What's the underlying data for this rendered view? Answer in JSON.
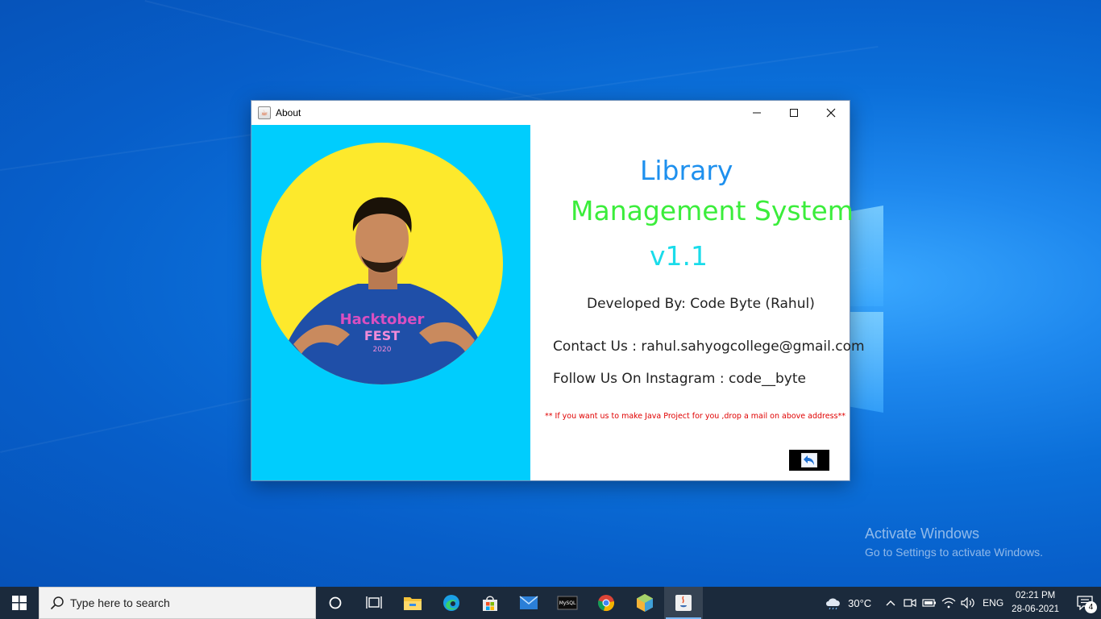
{
  "window": {
    "title": "About",
    "controls": {
      "minimize": "—",
      "maximize": "☐",
      "close": "✕"
    }
  },
  "about": {
    "line1": "Library",
    "line2": "Management System",
    "version": "v1.1",
    "developed_by": "Developed By: Code Byte (Rahul)",
    "contact": "Contact Us : rahul.sahyogcollege@gmail.com",
    "instagram": "Follow Us On Instagram : code__byte",
    "note": "** If you want us to make Java Project for you ,drop a mail on above address**"
  },
  "colors": {
    "library": "#1e90ee",
    "management": "#3bed3b",
    "version": "#1adcea",
    "left_panel": "#00cdfd",
    "circle": "#fde92c",
    "note": "#e00000"
  },
  "shirt_text": {
    "line1": "Hacktober",
    "line2": "FEST",
    "line3": "2020"
  },
  "activation": {
    "title": "Activate Windows",
    "subtitle": "Go to Settings to activate Windows."
  },
  "taskbar": {
    "search_placeholder": "Type here to search",
    "apps": [
      "cortana-icon",
      "task-view-icon",
      "file-explorer-icon",
      "edge-icon",
      "store-icon",
      "mail-icon",
      "mysql-icon",
      "chrome-icon",
      "netbeans-icon",
      "java-icon"
    ],
    "weather": "30°C",
    "language": "ENG",
    "time": "02:21 PM",
    "date": "28-06-2021",
    "notifications": "4"
  }
}
